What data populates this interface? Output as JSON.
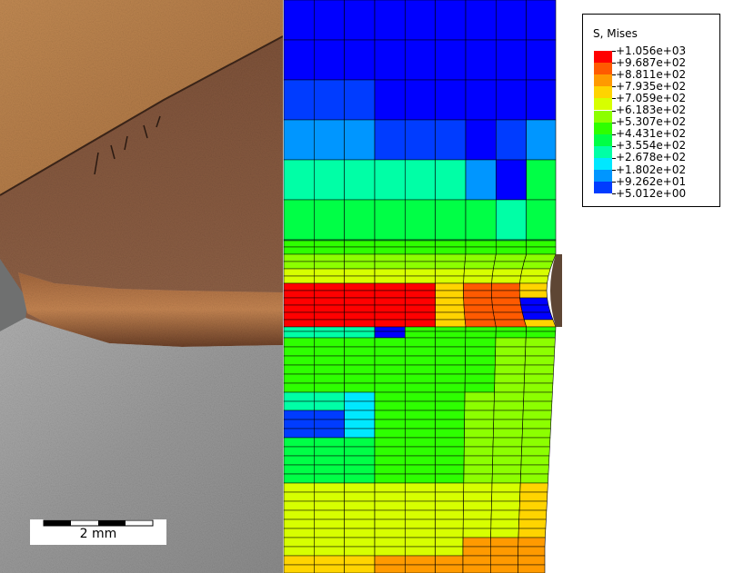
{
  "legend": {
    "title": "S, Mises",
    "entries": [
      {
        "label": "+1.056e+03",
        "color": "#ff0000"
      },
      {
        "label": "+9.687e+02",
        "color": "#ff5a00"
      },
      {
        "label": "+8.811e+02",
        "color": "#ff9a00"
      },
      {
        "label": "+7.935e+02",
        "color": "#ffd400"
      },
      {
        "label": "+7.059e+02",
        "color": "#d7ff00"
      },
      {
        "label": "+6.183e+02",
        "color": "#8cff00"
      },
      {
        "label": "+5.307e+02",
        "color": "#2eff00"
      },
      {
        "label": "+4.431e+02",
        "color": "#00ff46"
      },
      {
        "label": "+3.554e+02",
        "color": "#00ffa6"
      },
      {
        "label": "+2.678e+02",
        "color": "#00e8ff"
      },
      {
        "label": "+1.802e+02",
        "color": "#0096ff"
      },
      {
        "label": "+9.262e+01",
        "color": "#003cff"
      },
      {
        "label": "+5.012e+00",
        "color": "#0000ff"
      }
    ]
  },
  "scale_bar": {
    "label": "2 mm"
  },
  "colors": {
    "copper_light": "#b9834f",
    "copper_dark": "#8a5d3e",
    "steel": "#9d9d9d",
    "mesh_line": "#000000"
  }
}
